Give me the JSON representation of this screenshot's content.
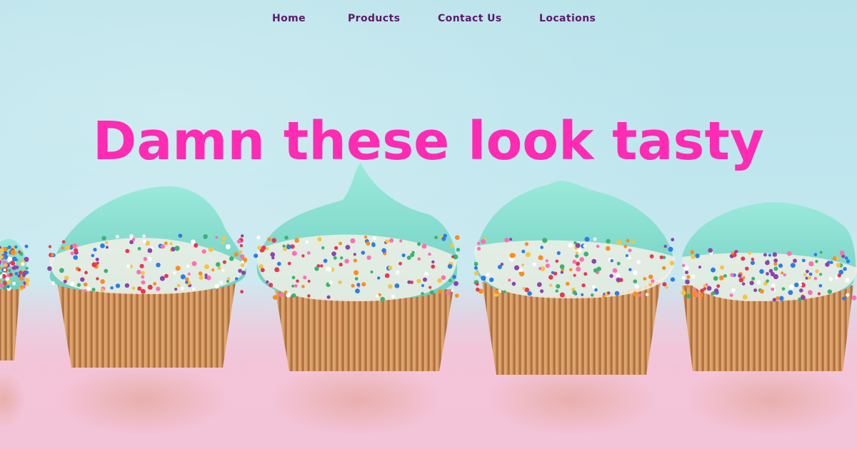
{
  "nav": {
    "items": [
      {
        "label": "Home"
      },
      {
        "label": "Products"
      },
      {
        "label": "Contact Us"
      },
      {
        "label": "Locations"
      }
    ]
  },
  "hero": {
    "title": "Damn these look tasty",
    "image_subject": "cupcake-row-photo"
  },
  "colors": {
    "title": "#ff2bb3",
    "nav_text": "#5a1a6b",
    "frosting": "#8ee0d2",
    "liner": "#d9a06a",
    "background_top": "#b9e3ea",
    "background_bottom": "#f3c3d7"
  }
}
